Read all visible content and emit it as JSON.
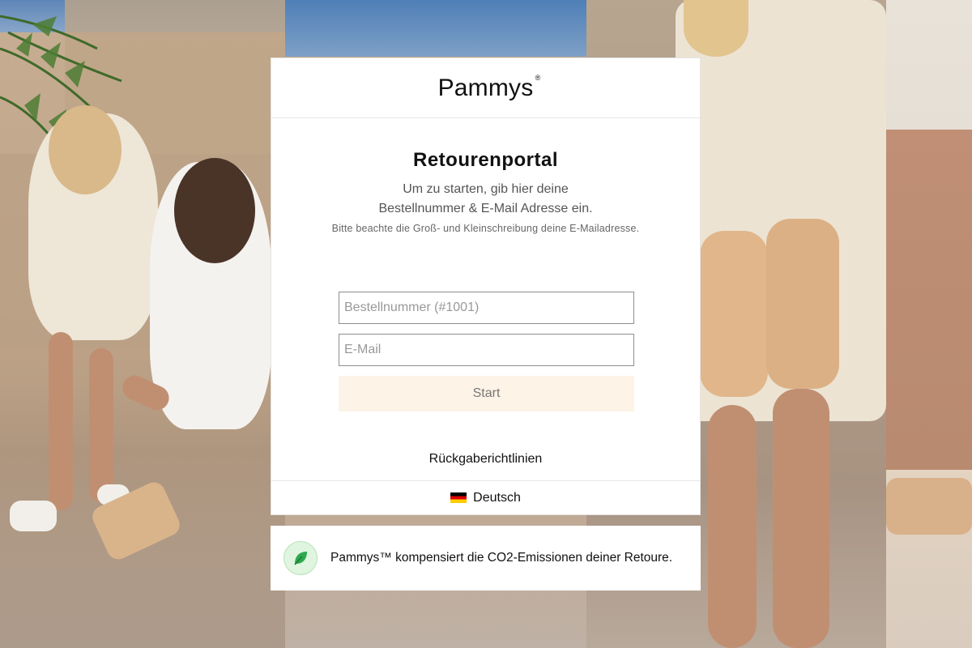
{
  "brand": {
    "name": "Pammys",
    "registered_mark": "®"
  },
  "portal": {
    "title": "Retourenportal",
    "subtitle_line1": "Um zu starten, gib hier deine",
    "subtitle_line2": "Bestellnummer & E-Mail Adresse ein.",
    "case_note": "Bitte beachte die Groß- und Kleinschreibung deine E-Mailadresse."
  },
  "form": {
    "order_placeholder": "Bestellnummer (#1001)",
    "email_placeholder": "E-Mail",
    "start_label": "Start"
  },
  "links": {
    "return_policy": "Rückgaberichtlinien"
  },
  "language": {
    "label": "Deutsch",
    "flag_icon": "germany-flag-icon"
  },
  "eco": {
    "icon": "leaf-icon",
    "text": "Pammys™ kompensiert die CO2-Emissionen deiner Retoure."
  },
  "colors": {
    "start_button_bg": "#fdf3e6",
    "eco_icon_bg": "#dff5df",
    "leaf": "#2fa84f"
  }
}
